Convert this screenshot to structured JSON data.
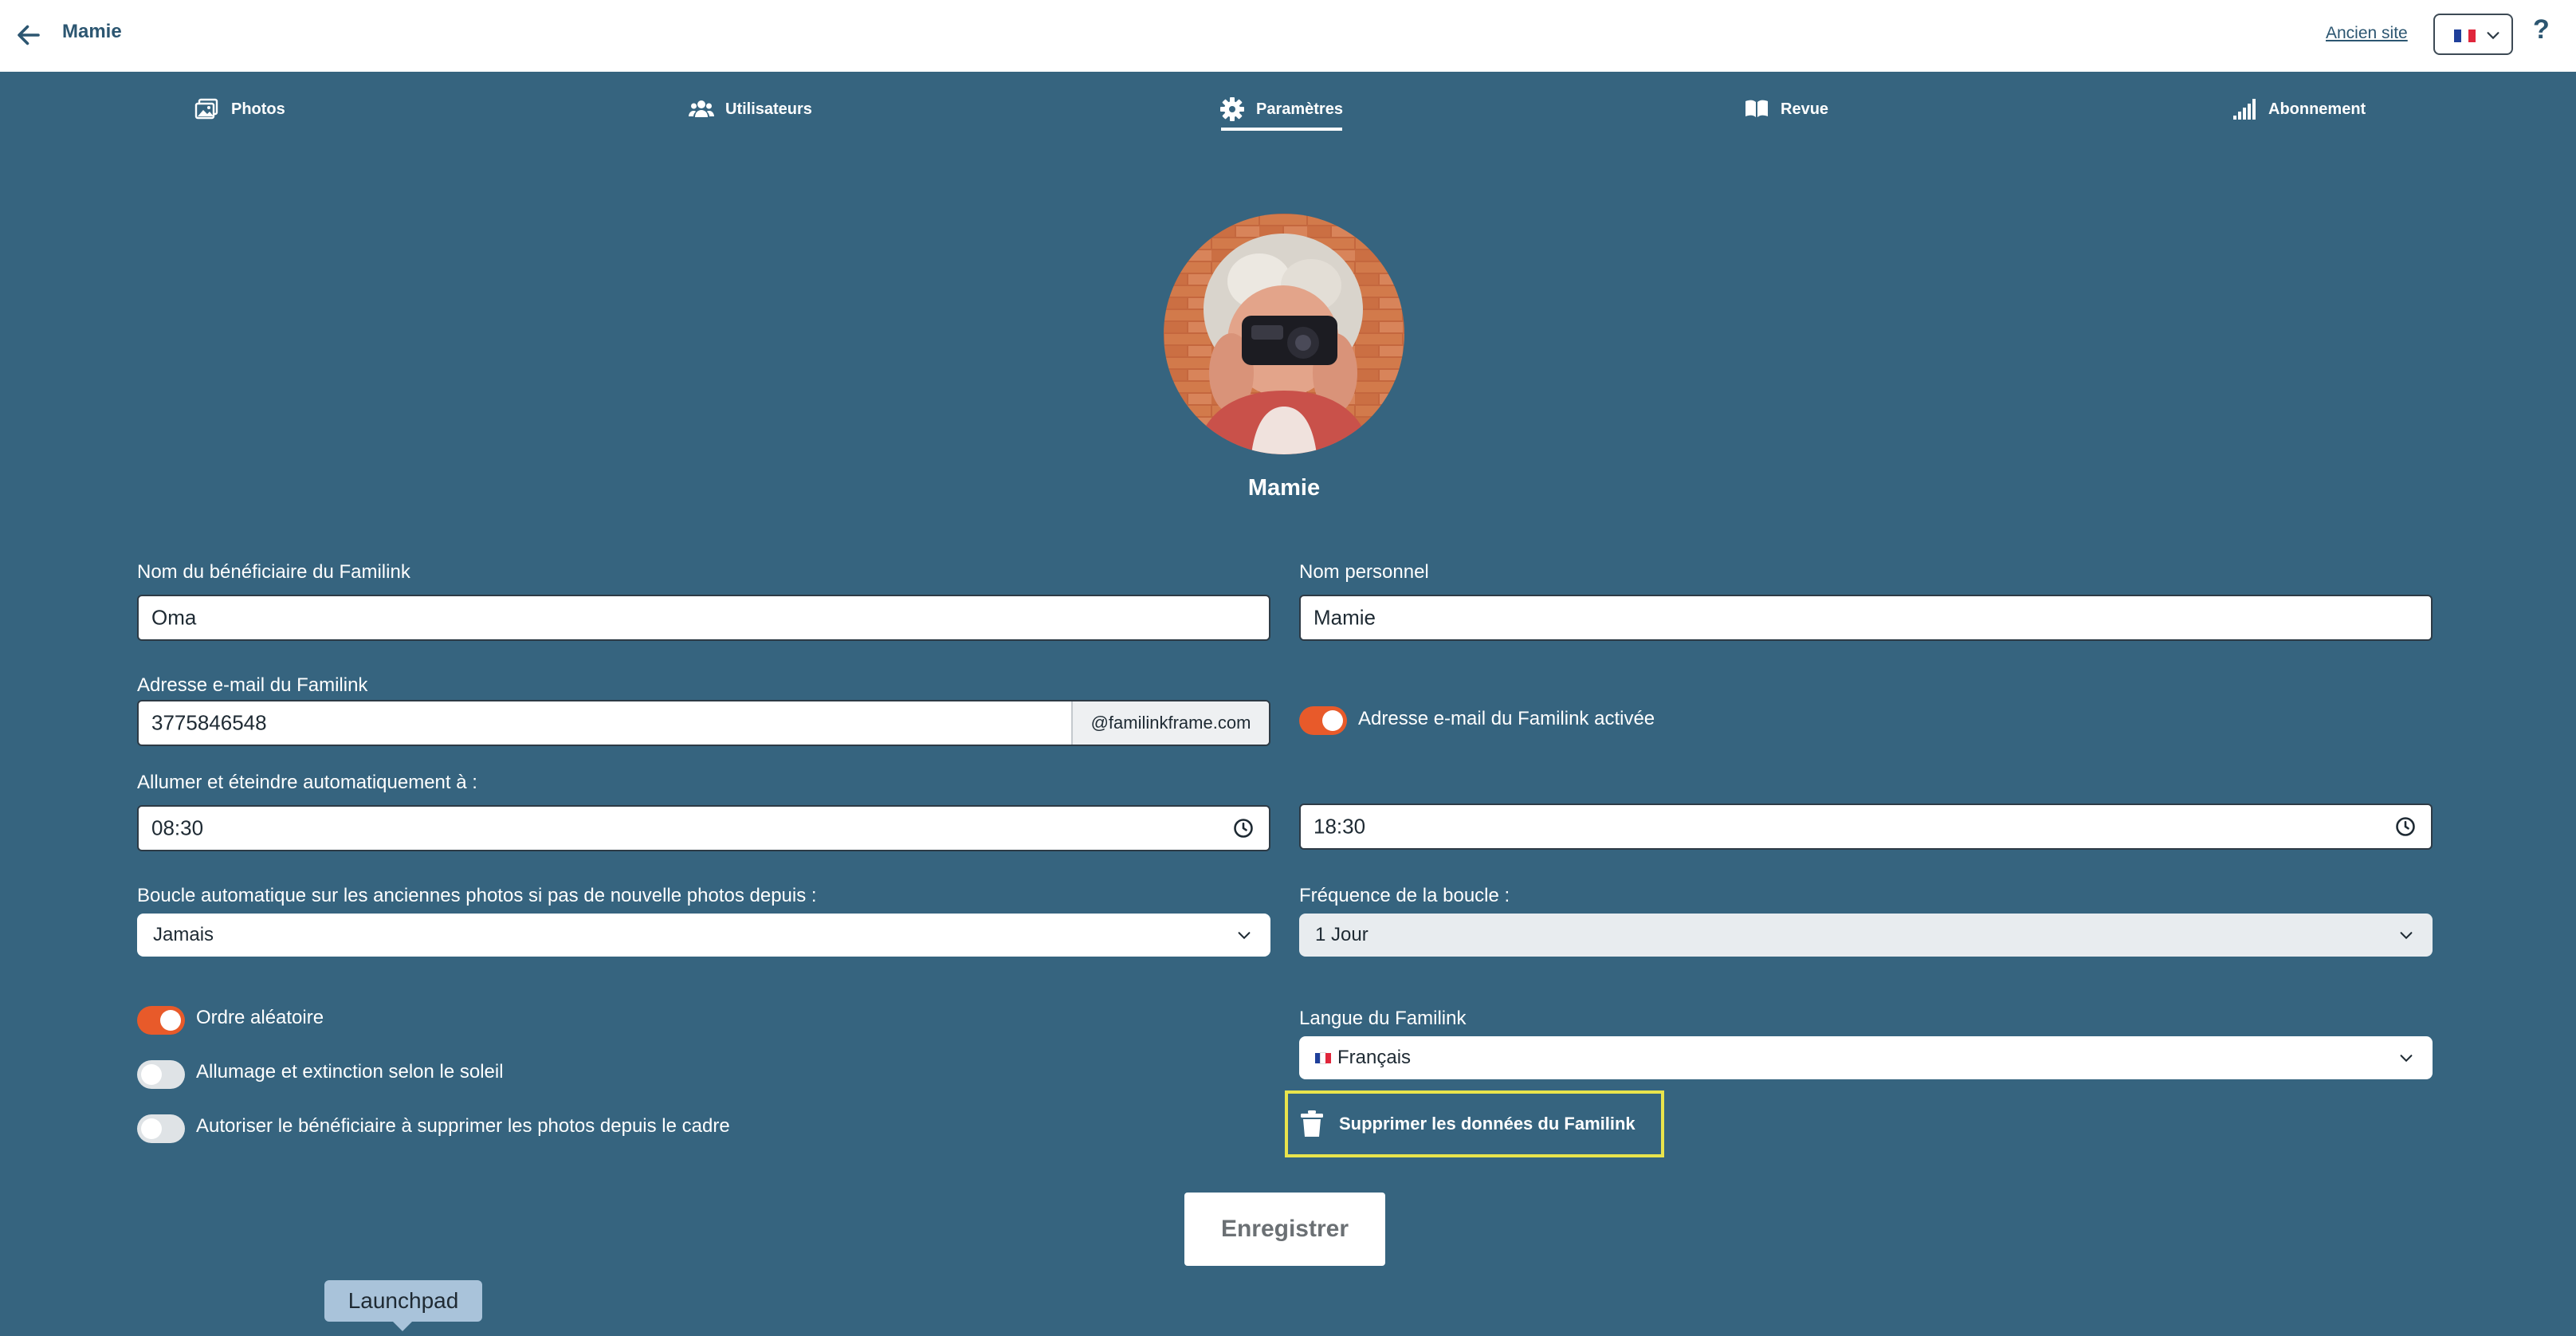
{
  "header": {
    "title": "Mamie",
    "old_site_link": "Ancien site",
    "help_label": "?"
  },
  "tabs": [
    {
      "label": "Photos",
      "icon": "photos-icon"
    },
    {
      "label": "Utilisateurs",
      "icon": "users-icon"
    },
    {
      "label": "Paramètres",
      "icon": "gear-icon",
      "active": true
    },
    {
      "label": "Revue",
      "icon": "book-icon"
    },
    {
      "label": "Abonnement",
      "icon": "signal-bars-icon"
    }
  ],
  "profile": {
    "name": "Mamie"
  },
  "form": {
    "beneficiary_label": "Nom du bénéficiaire du Familink",
    "beneficiary_value": "Oma",
    "personal_name_label": "Nom personnel",
    "personal_name_value": "Mamie",
    "email_label": "Adresse e-mail du Familink",
    "email_value": "3775846548",
    "email_suffix": "@familinkframe.com",
    "email_enabled_label": "Adresse e-mail du Familink activée",
    "email_enabled": true,
    "auto_power_label": "Allumer et éteindre automatiquement à :",
    "power_on_time": "08:30",
    "power_off_time": "18:30",
    "loop_label": "Boucle automatique sur les anciennes photos si pas de nouvelle photos depuis :",
    "loop_value": "Jamais",
    "loop_frequency_label": "Fréquence de la boucle :",
    "loop_frequency_value": "1 Jour",
    "random_order_label": "Ordre aléatoire",
    "random_order": true,
    "sun_power_label": "Allumage et extinction selon le soleil",
    "sun_power": false,
    "allow_delete_label": "Autoriser le bénéficiaire à supprimer les photos depuis le cadre",
    "allow_delete": false,
    "language_label": "Langue du Familink",
    "language_value": "Français",
    "delete_data_label": "Supprimer les données du Familink",
    "save_label": "Enregistrer"
  },
  "dock": {
    "tooltip": "Launchpad"
  },
  "colors": {
    "background": "#36647f",
    "toggle_on": "#e85a2a",
    "highlight": "#e9e44c",
    "header_text": "#2c5671"
  }
}
